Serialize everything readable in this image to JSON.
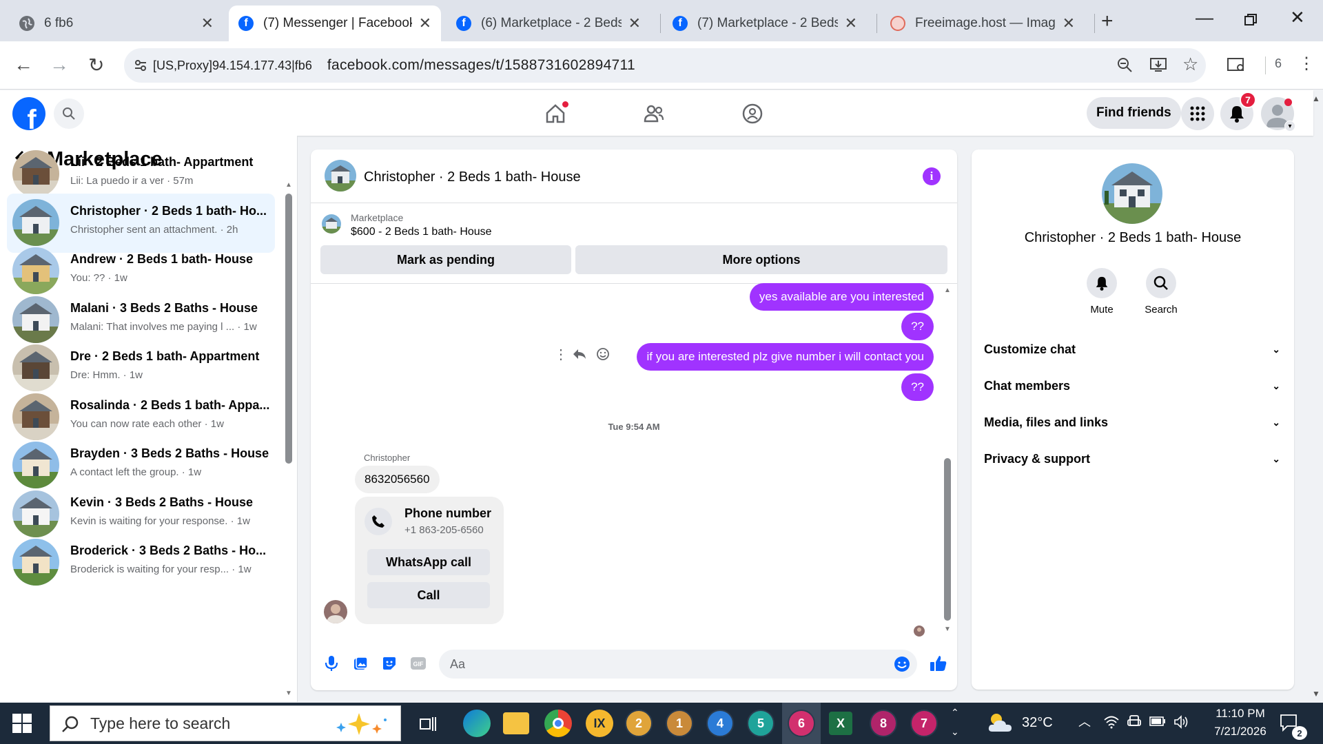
{
  "browser": {
    "tabs": [
      {
        "label": "6 fb6",
        "icon": "globe-icon"
      },
      {
        "label": "(7) Messenger | Facebook",
        "icon": "facebook-icon"
      },
      {
        "label": "(6) Marketplace - 2 Beds 1",
        "icon": "facebook-icon"
      },
      {
        "label": "(7) Marketplace - 2 Beds 1",
        "icon": "facebook-icon"
      },
      {
        "label": "Freeimage.host — Image",
        "icon": "freeimage-icon"
      }
    ],
    "site_info": "[US,Proxy]94.154.177.43|fb6",
    "url": "facebook.com/messages/t/1588731602894711",
    "profile_count": "6"
  },
  "fb": {
    "find_friends": "Find friends",
    "notification_count": "7"
  },
  "left": {
    "title": "Marketplace",
    "conversations": [
      {
        "name": "Lii · 2 Beds 1 bath- Appartment",
        "preview": "Lii: La puedo ir a ver · 57m"
      },
      {
        "name": "Christopher · 2 Beds 1 bath- Ho...",
        "preview": "Christopher sent an attachment. · 2h"
      },
      {
        "name": "Andrew · 2 Beds 1 bath- House",
        "preview": "You: ?? · 1w"
      },
      {
        "name": "Malani · 3 Beds 2 Baths - House",
        "preview": "Malani: That involves me paying l ... · 1w"
      },
      {
        "name": "Dre · 2 Beds 1 bath- Appartment",
        "preview": "Dre: Hmm. · 1w"
      },
      {
        "name": "Rosalinda · 2 Beds 1 bath- Appa...",
        "preview": "You can now rate each other · 1w"
      },
      {
        "name": "Brayden · 3 Beds 2 Baths - House",
        "preview": "A contact left the group. · 1w"
      },
      {
        "name": "Kevin · 3 Beds 2 Baths - House",
        "preview": "Kevin is waiting for your response. · 1w"
      },
      {
        "name": "Broderick · 3 Beds 2 Baths - Ho...",
        "preview": "Broderick is waiting for your resp... · 1w"
      }
    ]
  },
  "chat": {
    "title": "Christopher · 2 Beds 1 bath- House",
    "marketplace_label": "Marketplace",
    "listing": "$600 - 2 Beds 1 bath- House",
    "mark_pending": "Mark as pending",
    "more_options": "More options",
    "messages_out": [
      "yes available are you interested",
      "??",
      "if you are interested plz give number i will contact you",
      "??"
    ],
    "timestamp": "Tue 9:54 AM",
    "sender": "Christopher",
    "incoming_text": "8632056560",
    "phone_card": {
      "title": "Phone number",
      "number": "+1 863-205-6560",
      "whatsapp": "WhatsApp call",
      "call": "Call"
    },
    "composer_placeholder": "Aa"
  },
  "right": {
    "name": "Christopher · 2 Beds 1 bath- House",
    "mute": "Mute",
    "search": "Search",
    "sections": [
      "Customize chat",
      "Chat members",
      "Media, files and links",
      "Privacy & support"
    ]
  },
  "taskbar": {
    "search_placeholder": "Type here to search",
    "apps": [
      "2",
      "1",
      "4",
      "5",
      "6",
      "8",
      "7"
    ],
    "temperature": "32°C",
    "time": "11:10 PM",
    "date": "7/21/2026",
    "notification_count": "2"
  },
  "colors": {
    "messenger_purple": "#a033ff",
    "facebook_blue": "#0866ff",
    "active_conv_bg": "#ebf5ff"
  }
}
